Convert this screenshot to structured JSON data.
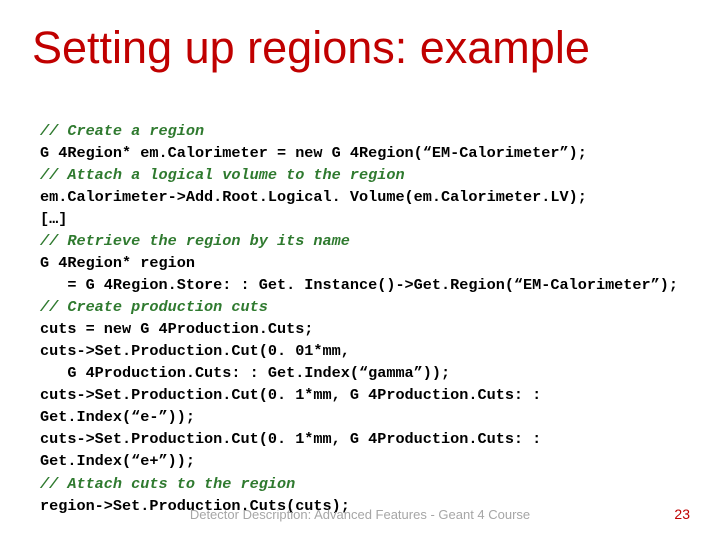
{
  "slide": {
    "title": "Setting up regions: example",
    "footer": "Detector Description: Advanced Features - Geant 4 Course",
    "page_number": "23",
    "code": {
      "l01": "// Create a region",
      "l02": "G 4Region* em.Calorimeter = new G 4Region(“EM-Calorimeter”);",
      "l03": "// Attach a logical volume to the region",
      "l04": "em.Calorimeter->Add.Root.Logical. Volume(em.Calorimeter.LV);",
      "l05": "[…]",
      "l06": "// Retrieve the region by its name",
      "l07": "G 4Region* region",
      "l08": "   = G 4Region.Store: : Get. Instance()->Get.Region(“EM-Calorimeter”);",
      "l09": "// Create production cuts",
      "l10": "cuts = new G 4Production.Cuts;",
      "l11": "cuts->Set.Production.Cut(0. 01*mm,",
      "l12": "   G 4Production.Cuts: : Get.Index(“gamma”));",
      "l13": "cuts->Set.Production.Cut(0. 1*mm, G 4Production.Cuts: : Get.Index(“e-”));",
      "l14": "cuts->Set.Production.Cut(0. 1*mm, G 4Production.Cuts: : Get.Index(“e+”));",
      "l15": "// Attach cuts to the region",
      "l16": "region->Set.Production.Cuts(cuts);"
    }
  }
}
